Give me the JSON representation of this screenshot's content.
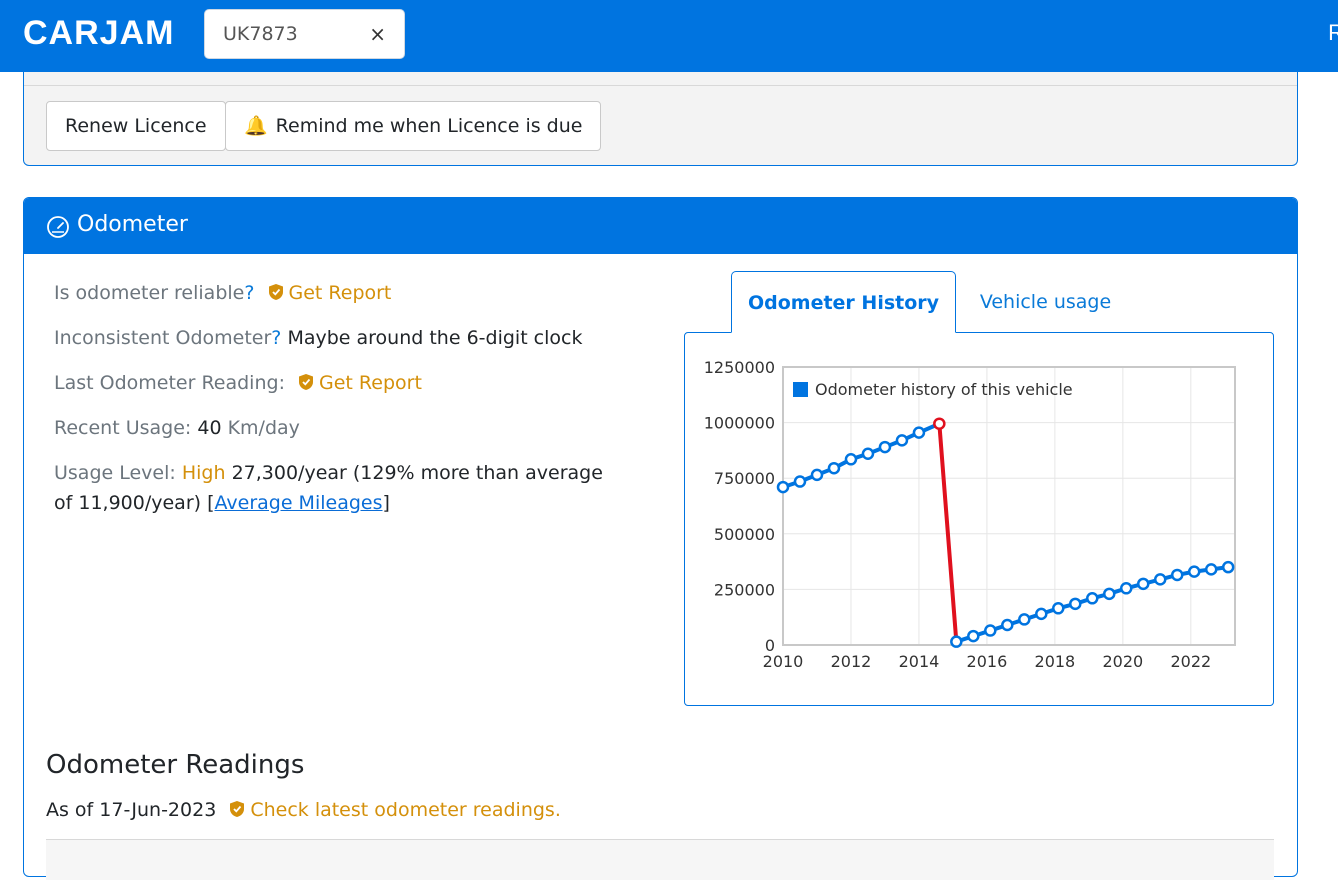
{
  "header": {
    "logo": "CARJAM",
    "search_value": "UK7873",
    "clear_symbol": "×",
    "edge_text": "R"
  },
  "licence": {
    "renew_label": "Renew Licence",
    "remind_label": "Remind me when Licence is due"
  },
  "odometer": {
    "title": "Odometer",
    "reliable_label": "Is odometer reliable",
    "reliable_q": "?",
    "get_report": "Get Report",
    "inconsistent_label": "Inconsistent Odometer",
    "inconsistent_q": "?",
    "inconsistent_value": "Maybe around the 6-digit clock",
    "last_label": "Last Odometer Reading:",
    "recent_label": "Recent Usage:",
    "recent_value": "40",
    "recent_unit": "Km/day",
    "level_label": "Usage Level:",
    "level_value": "High",
    "level_detail": "27,300/year (129% more than average of 11,900/year) [",
    "level_link": "Average Mileages",
    "level_close": "]"
  },
  "tabs": {
    "history": "Odometer History",
    "usage": "Vehicle usage"
  },
  "readings": {
    "title": "Odometer Readings",
    "as_of": "As of 17-Jun-2023",
    "check_link": "Check latest odometer readings."
  },
  "colors": {
    "brand": "#0074e0",
    "gold": "#d4900b",
    "rollback": "#e0101e"
  },
  "chart_data": {
    "type": "line",
    "legend": "Odometer history of this vehicle",
    "xlim": [
      2010,
      2023.3
    ],
    "ylim": [
      0,
      1250000
    ],
    "x_ticks": [
      2010,
      2012,
      2014,
      2016,
      2018,
      2020,
      2022
    ],
    "y_ticks": [
      0,
      250000,
      500000,
      750000,
      1000000,
      1250000
    ],
    "grid": true,
    "series": [
      {
        "name": "Odometer history of this vehicle",
        "x": [
          2010.0,
          2010.5,
          2011.0,
          2011.5,
          2012.0,
          2012.5,
          2013.0,
          2013.5,
          2014.0,
          2014.6,
          2015.1,
          2015.6,
          2016.1,
          2016.6,
          2017.1,
          2017.6,
          2018.1,
          2018.6,
          2019.1,
          2019.6,
          2020.1,
          2020.6,
          2021.1,
          2021.6,
          2022.1,
          2022.6,
          2023.1
        ],
        "y": [
          710000,
          735000,
          765000,
          795000,
          835000,
          860000,
          890000,
          920000,
          955000,
          995000,
          15000,
          40000,
          65000,
          90000,
          115000,
          140000,
          165000,
          185000,
          210000,
          230000,
          255000,
          275000,
          295000,
          315000,
          330000,
          340000,
          350000
        ],
        "rollback_index": 9
      }
    ]
  }
}
